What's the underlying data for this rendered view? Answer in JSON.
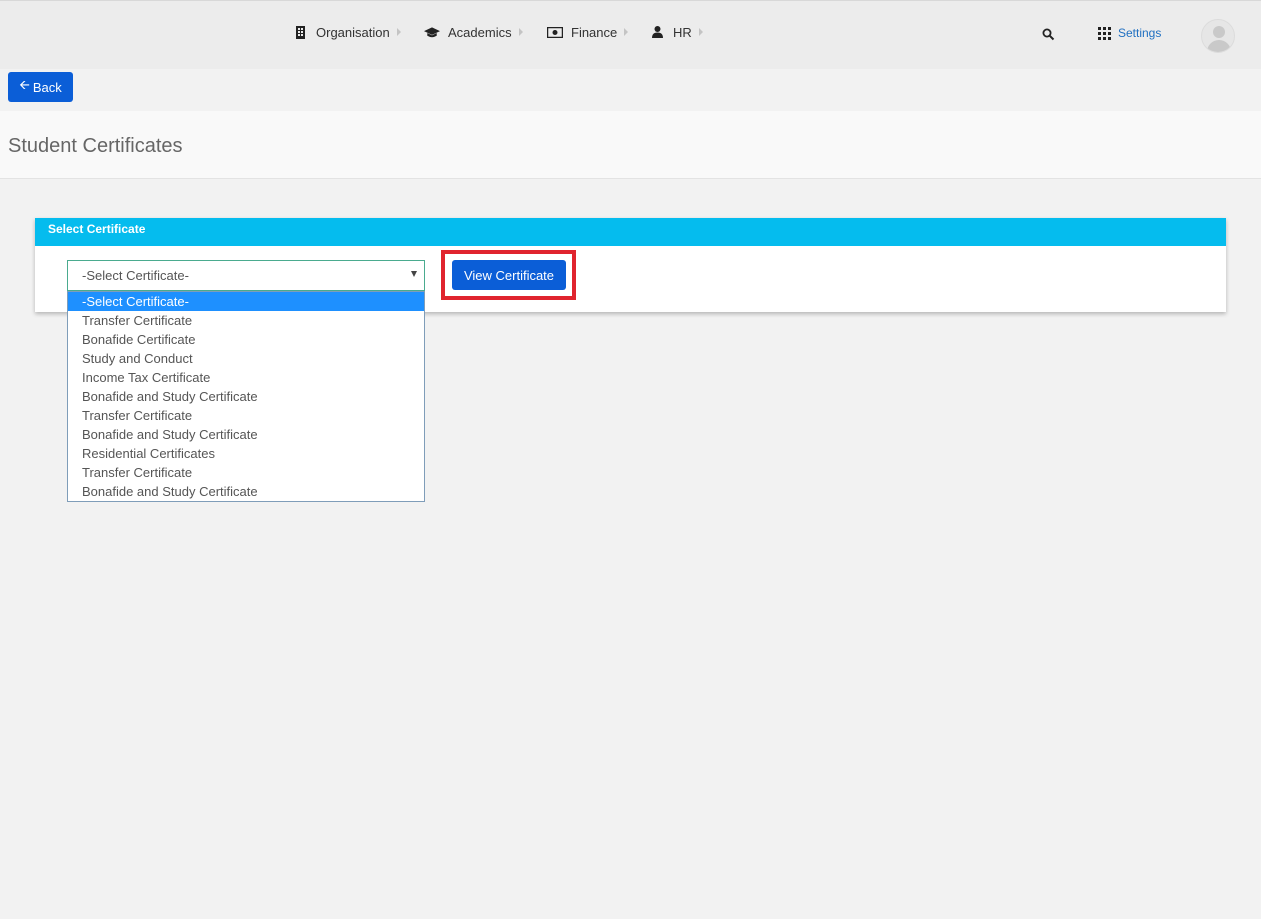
{
  "nav": {
    "items": [
      {
        "label": "Organisation",
        "icon": "building-icon"
      },
      {
        "label": "Academics",
        "icon": "graduation-cap-icon"
      },
      {
        "label": "Finance",
        "icon": "money-icon"
      },
      {
        "label": "HR",
        "icon": "user-icon"
      }
    ],
    "settings_label": "Settings"
  },
  "back_label": "Back",
  "page_title": "Student Certificates",
  "panel": {
    "heading": "Select Certificate",
    "select_value": "-Select Certificate-",
    "view_button_label": "View Certificate"
  },
  "dropdown": {
    "options": [
      "-Select Certificate-",
      "Transfer Certificate",
      "Bonafide Certificate",
      "Study and Conduct",
      "Income Tax Certificate",
      "Bonafide and Study Certificate",
      "Transfer Certificate",
      "Bonafide and Study Certificate",
      "Residential Certificates",
      "Transfer Certificate",
      "Bonafide and Study Certificate"
    ],
    "selected_index": 0
  },
  "colors": {
    "primary_button": "#0b5ed7",
    "panel_header": "#05bcee",
    "highlight": "#e0242e",
    "option_selected": "#1e90ff",
    "settings_link": "#1f6fc1"
  }
}
